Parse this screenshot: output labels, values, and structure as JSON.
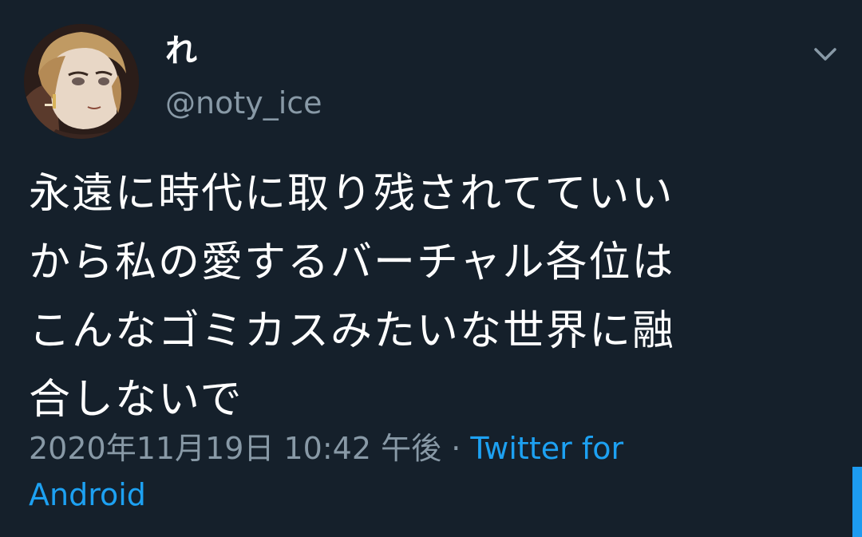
{
  "tweet": {
    "display_name": "れ",
    "handle": "@noty_ice",
    "text_lines": [
      "永遠に時代に取り残されてていい",
      "から私の愛するバーチャル各位は",
      "こんなゴミカスみたいな世界に融",
      "合しないで"
    ],
    "timestamp": "2020年11月19日 10:42 午後",
    "separator": "·",
    "source_line1": "Twitter for",
    "source_line2": "Android"
  },
  "icons": {
    "avatar": "avatar-image",
    "menu": "chevron-down-icon"
  },
  "colors": {
    "background": "#15202b",
    "primary_text": "#ffffff",
    "secondary_text": "#8899a6",
    "link": "#1da1f2"
  }
}
